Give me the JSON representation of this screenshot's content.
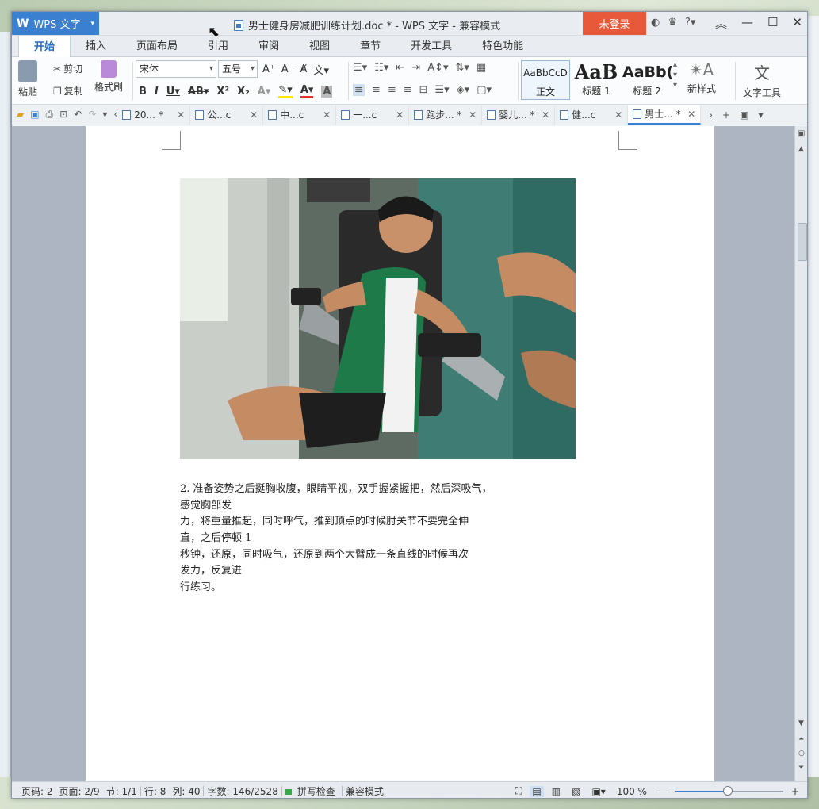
{
  "app": {
    "name": "WPS 文字",
    "logo_glyph": "W"
  },
  "title": {
    "doc_title": "男士健身房减肥训练计划.doc * - WPS 文字 - 兼容模式"
  },
  "login_label": "未登录",
  "title_icons": [
    "skin-icon",
    "shirt-icon",
    "help-icon"
  ],
  "help_label": "?",
  "ribbon_tabs": [
    "开始",
    "插入",
    "页面布局",
    "引用",
    "审阅",
    "视图",
    "章节",
    "开发工具",
    "特色功能"
  ],
  "clipboard": {
    "paste": "粘贴",
    "cut": "剪切",
    "copy": "复制",
    "format_painter": "格式刷"
  },
  "font": {
    "name": "宋体",
    "size": "五号"
  },
  "styles": [
    {
      "preview": "AaBbCcD",
      "label": "正文"
    },
    {
      "preview": "AaB",
      "label": "标题 1"
    },
    {
      "preview": "AaBb(",
      "label": "标题 2"
    }
  ],
  "new_style": "新样式",
  "text_tools": "文字工具",
  "doc_tabs": [
    {
      "label": "20...",
      "mark": "*",
      "active": false
    },
    {
      "label": "公...c",
      "mark": "",
      "active": false
    },
    {
      "label": "中...c",
      "mark": "",
      "active": false
    },
    {
      "label": "一...c",
      "mark": "",
      "active": false
    },
    {
      "label": "跑步...",
      "mark": "*",
      "active": false
    },
    {
      "label": "婴儿...",
      "mark": "*",
      "active": false
    },
    {
      "label": "健...c",
      "mark": "",
      "active": false
    },
    {
      "label": "男士...",
      "mark": "*",
      "active": true
    }
  ],
  "document": {
    "paragraph_lines": [
      "             2. 准备姿势之后挺胸收腹，眼睛平视，双手握紧握把，然后深吸气，",
      "感觉胸部发",
      "             力，将重量推起，同时呼气，推到顶点的时候肘关节不要完全伸",
      "直，之后停顿 1",
      "             秒钟，还原，同时吸气，还原到两个大臂成一条直线的时候再次",
      "发力，反复进",
      "             行练习。"
    ]
  },
  "status": {
    "page_label": "页码: 2",
    "pages": "页面: 2/9",
    "section": "节: 1/1",
    "row": "行: 8",
    "col": "列: 40",
    "words": "字数: 146/2528",
    "spellcheck": "拼写检查",
    "mode": "兼容模式",
    "zoom": "100 %"
  },
  "colors": {
    "accent": "#3a7fd0",
    "login_bg": "#e8583b"
  }
}
